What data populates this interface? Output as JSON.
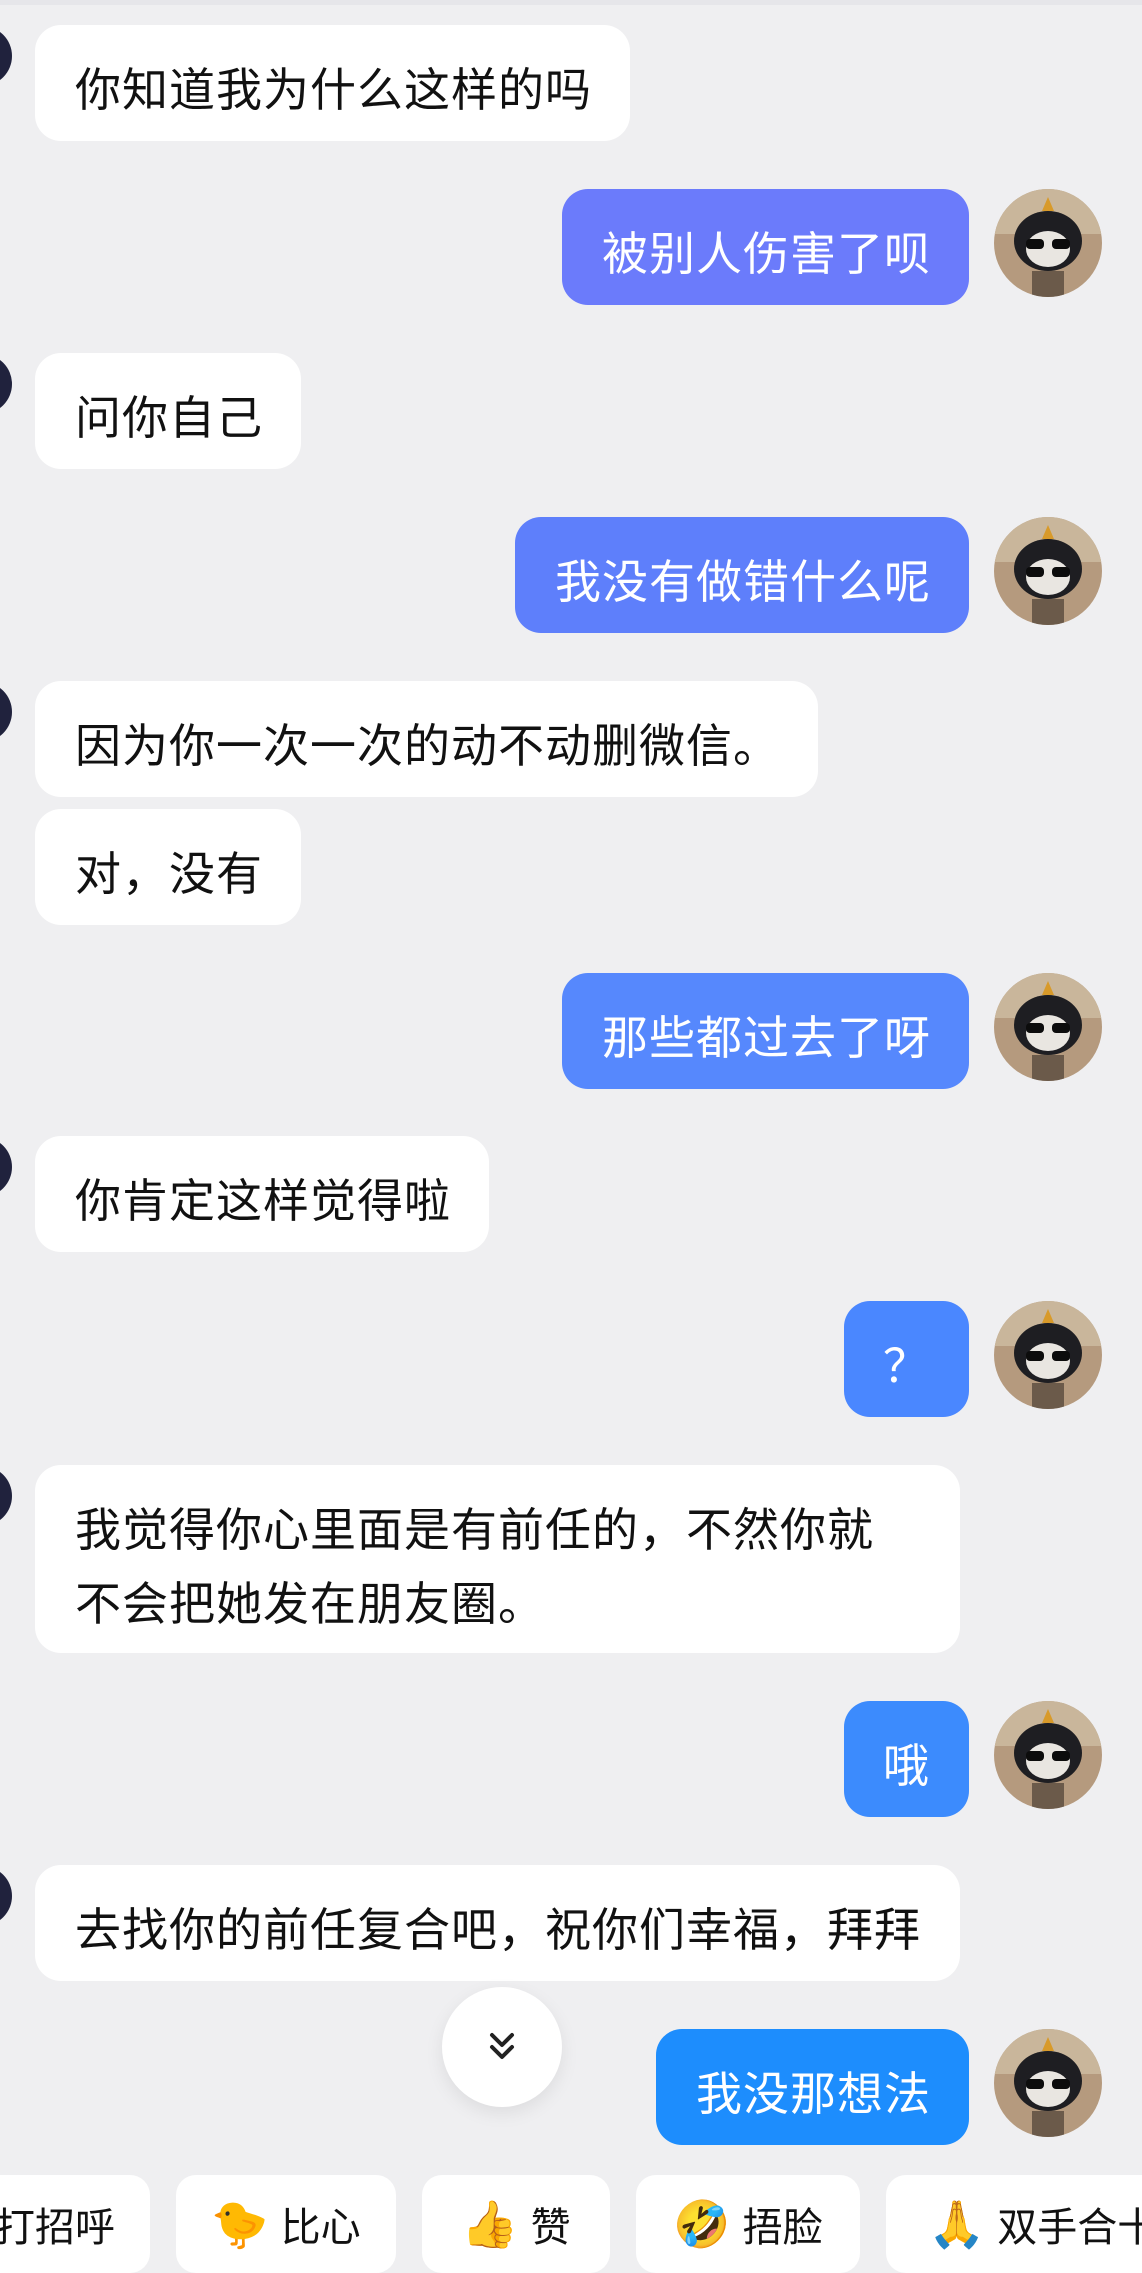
{
  "colors": {
    "out_bubble_purple": "#6b7bfb",
    "out_bubble_blue": "#4a87ff",
    "out_bubble_sky": "#1d8dfd"
  },
  "messages": [
    {
      "side": "in",
      "text": "你知道我为什么这样的吗"
    },
    {
      "side": "out",
      "text": "被别人伤害了呗"
    },
    {
      "side": "in",
      "text": "问你自己"
    },
    {
      "side": "out",
      "text": "我没有做错什么呢"
    },
    {
      "side": "in",
      "text": "因为你一次一次的动不动删微信。"
    },
    {
      "side": "in",
      "text": "对，没有"
    },
    {
      "side": "out",
      "text": "那些都过去了呀"
    },
    {
      "side": "in",
      "text": "你肯定这样觉得啦"
    },
    {
      "side": "out",
      "text": "？"
    },
    {
      "side": "in",
      "text": "我觉得你心里面是有前任的，不然你就不会把她发在朋友圈。"
    },
    {
      "side": "out",
      "text": "哦"
    },
    {
      "side": "in",
      "text": "去找你的前任复合吧，祝你们幸福，拜拜"
    },
    {
      "side": "out",
      "text": "我没那想法"
    }
  ],
  "quick_replies": [
    {
      "icon": "",
      "label": "打招呼"
    },
    {
      "icon": "🐤",
      "label": "比心"
    },
    {
      "icon": "👍",
      "label": "赞"
    },
    {
      "icon": "🤣",
      "label": "捂脸"
    },
    {
      "icon": "🙏",
      "label": "双手合十"
    }
  ],
  "scroll_icon": "chevron-double-down-icon"
}
